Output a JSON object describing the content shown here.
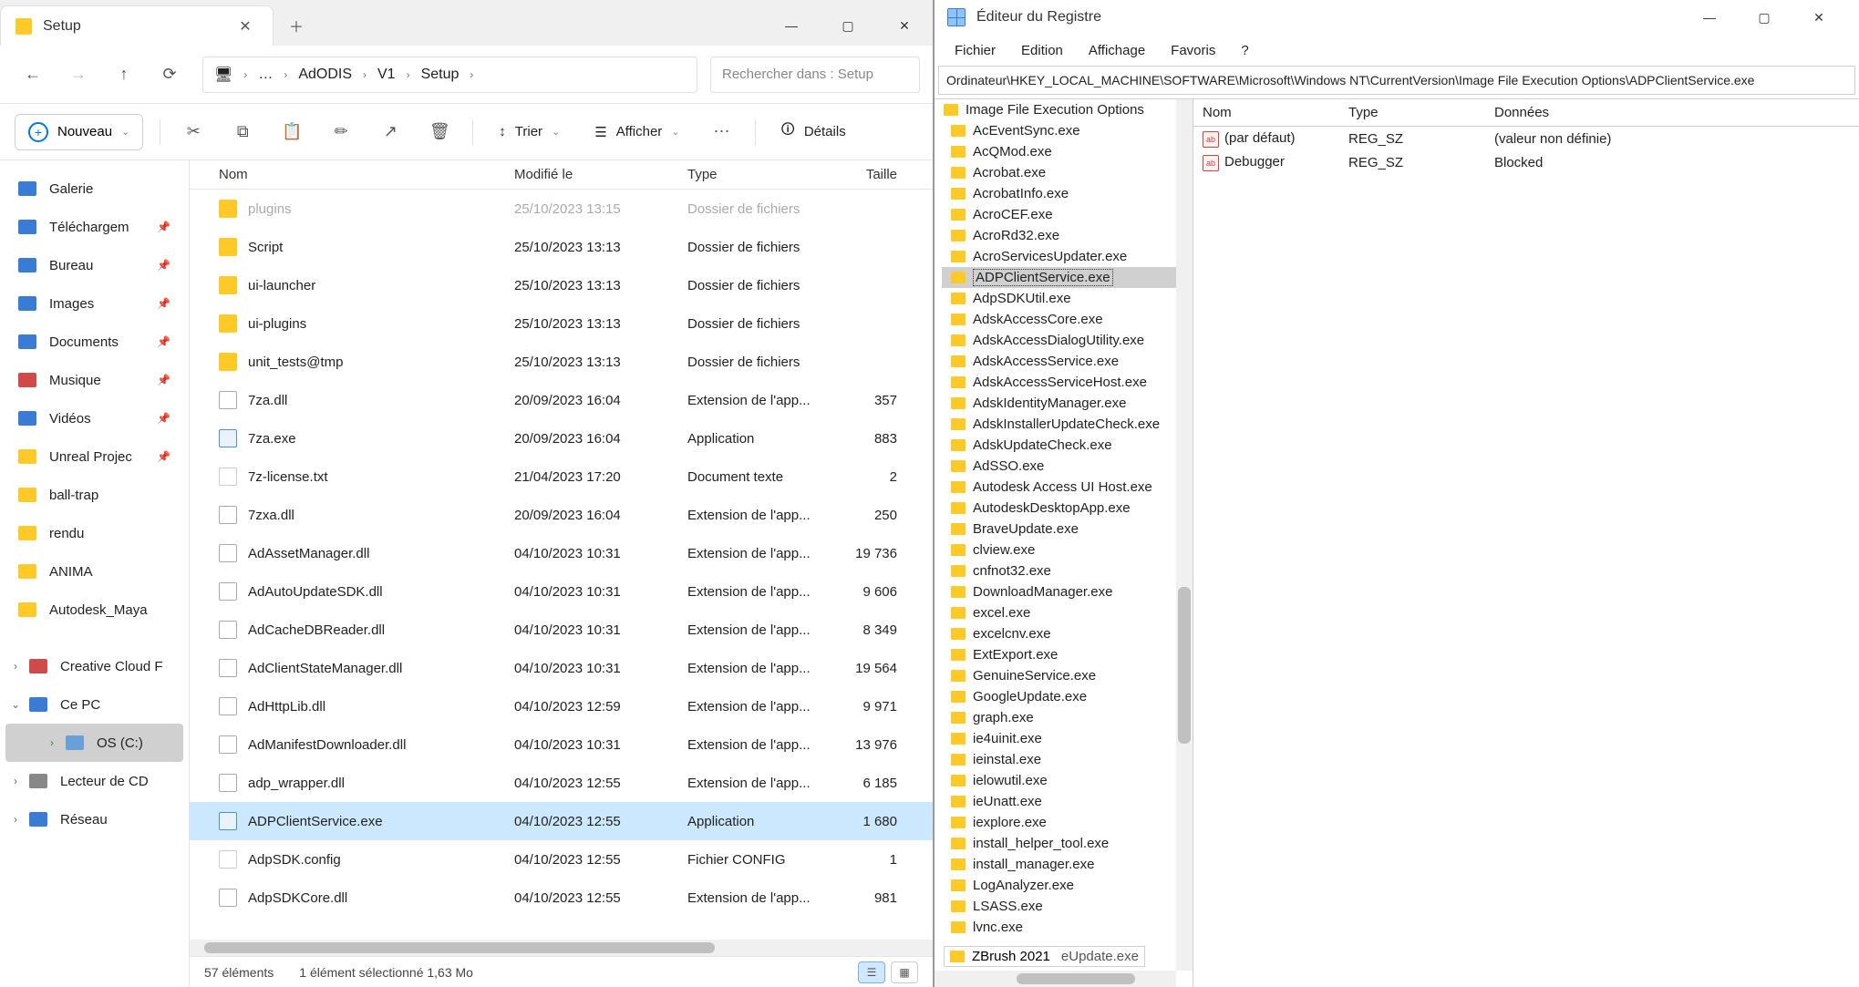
{
  "explorer": {
    "tab_title": "Setup",
    "search_placeholder": "Rechercher dans : Setup",
    "nav": {
      "back": "←",
      "fwd": "→",
      "up": "↑",
      "refresh": "⟳",
      "pc": "🖥"
    },
    "breadcrumbs": [
      "…",
      "AdODIS",
      "V1",
      "Setup"
    ],
    "toolbar": {
      "new": "Nouveau",
      "sort": "Trier",
      "view": "Afficher",
      "details": "Détails"
    },
    "sidebar": [
      {
        "label": "Galerie",
        "color": "#3a7bd5"
      },
      {
        "label": "Téléchargem",
        "color": "#3a7bd5",
        "pin": true
      },
      {
        "label": "Bureau",
        "color": "#3a7bd5",
        "pin": true
      },
      {
        "label": "Images",
        "color": "#3a7bd5",
        "pin": true
      },
      {
        "label": "Documents",
        "color": "#3a7bd5",
        "pin": true
      },
      {
        "label": "Musique",
        "color": "#d04a4a",
        "pin": true
      },
      {
        "label": "Vidéos",
        "color": "#3a7bd5",
        "pin": true
      },
      {
        "label": "Unreal Projec",
        "color": "#ffca28",
        "pin": true
      },
      {
        "label": "ball-trap",
        "color": "#ffca28"
      },
      {
        "label": "rendu",
        "color": "#ffca28"
      },
      {
        "label": "ANIMA",
        "color": "#ffca28"
      },
      {
        "label": "Autodesk_Maya",
        "color": "#ffca28"
      }
    ],
    "sidebar_tree": [
      {
        "label": "Creative Cloud F",
        "color": "#d04a4a",
        "chev": ">"
      },
      {
        "label": "Ce PC",
        "color": "#3a7bd5",
        "chev": "v"
      },
      {
        "label": "OS (C:)",
        "color": "#6aa0d8",
        "chev": ">",
        "sel": true,
        "indent": true
      },
      {
        "label": "Lecteur de CD",
        "color": "#888",
        "chev": ">"
      },
      {
        "label": "Réseau",
        "color": "#3a7bd5",
        "chev": ">"
      }
    ],
    "columns": {
      "name": "Nom",
      "mod": "Modifié le",
      "type": "Type",
      "size": "Taille"
    },
    "files": [
      {
        "icon": "folder",
        "name": "plugins",
        "mod": "25/10/2023 13:15",
        "type": "Dossier de fichiers",
        "size": "",
        "dim": true
      },
      {
        "icon": "folder",
        "name": "Script",
        "mod": "25/10/2023 13:13",
        "type": "Dossier de fichiers",
        "size": ""
      },
      {
        "icon": "folder",
        "name": "ui-launcher",
        "mod": "25/10/2023 13:13",
        "type": "Dossier de fichiers",
        "size": ""
      },
      {
        "icon": "folder",
        "name": "ui-plugins",
        "mod": "25/10/2023 13:13",
        "type": "Dossier de fichiers",
        "size": ""
      },
      {
        "icon": "folder",
        "name": "unit_tests@tmp",
        "mod": "25/10/2023 13:13",
        "type": "Dossier de fichiers",
        "size": ""
      },
      {
        "icon": "dll",
        "name": "7za.dll",
        "mod": "20/09/2023 16:04",
        "type": "Extension de l'app...",
        "size": "357"
      },
      {
        "icon": "exe",
        "name": "7za.exe",
        "mod": "20/09/2023 16:04",
        "type": "Application",
        "size": "883"
      },
      {
        "icon": "file",
        "name": "7z-license.txt",
        "mod": "21/04/2023 17:20",
        "type": "Document texte",
        "size": "2"
      },
      {
        "icon": "dll",
        "name": "7zxa.dll",
        "mod": "20/09/2023 16:04",
        "type": "Extension de l'app...",
        "size": "250"
      },
      {
        "icon": "dll",
        "name": "AdAssetManager.dll",
        "mod": "04/10/2023 10:31",
        "type": "Extension de l'app...",
        "size": "19 736"
      },
      {
        "icon": "dll",
        "name": "AdAutoUpdateSDK.dll",
        "mod": "04/10/2023 10:31",
        "type": "Extension de l'app...",
        "size": "9 606"
      },
      {
        "icon": "dll",
        "name": "AdCacheDBReader.dll",
        "mod": "04/10/2023 10:31",
        "type": "Extension de l'app...",
        "size": "8 349"
      },
      {
        "icon": "dll",
        "name": "AdClientStateManager.dll",
        "mod": "04/10/2023 10:31",
        "type": "Extension de l'app...",
        "size": "19 564"
      },
      {
        "icon": "dll",
        "name": "AdHttpLib.dll",
        "mod": "04/10/2023 12:59",
        "type": "Extension de l'app...",
        "size": "9 971"
      },
      {
        "icon": "dll",
        "name": "AdManifestDownloader.dll",
        "mod": "04/10/2023 10:31",
        "type": "Extension de l'app...",
        "size": "13 976"
      },
      {
        "icon": "dll",
        "name": "adp_wrapper.dll",
        "mod": "04/10/2023 12:55",
        "type": "Extension de l'app...",
        "size": "6 185"
      },
      {
        "icon": "exe",
        "name": "ADPClientService.exe",
        "mod": "04/10/2023 12:55",
        "type": "Application",
        "size": "1 680",
        "selected": true
      },
      {
        "icon": "file",
        "name": "AdpSDK.config",
        "mod": "04/10/2023 12:55",
        "type": "Fichier CONFIG",
        "size": "1"
      },
      {
        "icon": "dll",
        "name": "AdpSDKCore.dll",
        "mod": "04/10/2023 12:55",
        "type": "Extension de l'app...",
        "size": "981"
      }
    ],
    "status": {
      "count": "57 éléments",
      "sel": "1 élément sélectionné  1,63 Mo"
    }
  },
  "regedit": {
    "title": "Éditeur du Registre",
    "menu": [
      "Fichier",
      "Edition",
      "Affichage",
      "Favoris",
      "?"
    ],
    "path": "Ordinateur\\HKEY_LOCAL_MACHINE\\SOFTWARE\\Microsoft\\Windows NT\\CurrentVersion\\Image File Execution Options\\ADPClientService.exe",
    "tree_root": "Image File Execution Options",
    "tree_items": [
      "AcEventSync.exe",
      "AcQMod.exe",
      "Acrobat.exe",
      "AcrobatInfo.exe",
      "AcroCEF.exe",
      "AcroRd32.exe",
      "AcroServicesUpdater.exe",
      "ADPClientService.exe",
      "AdpSDKUtil.exe",
      "AdskAccessCore.exe",
      "AdskAccessDialogUtility.exe",
      "AdskAccessService.exe",
      "AdskAccessServiceHost.exe",
      "AdskIdentityManager.exe",
      "AdskInstallerUpdateCheck.exe",
      "AdskUpdateCheck.exe",
      "AdSSO.exe",
      "Autodesk Access UI Host.exe",
      "AutodeskDesktopApp.exe",
      "BraveUpdate.exe",
      "clview.exe",
      "cnfnot32.exe",
      "DownloadManager.exe",
      "excel.exe",
      "excelcnv.exe",
      "ExtExport.exe",
      "GenuineService.exe",
      "GoogleUpdate.exe",
      "graph.exe",
      "ie4uinit.exe",
      "ieinstal.exe",
      "ielowutil.exe",
      "ieUnatt.exe",
      "iexplore.exe",
      "install_helper_tool.exe",
      "install_manager.exe",
      "LogAnalyzer.exe",
      "LSASS.exe",
      "lvnc.exe"
    ],
    "tree_selected": 7,
    "tree_overlay": "ZBrush 2021",
    "tree_overlay_tail": "eUpdate.exe",
    "columns": {
      "name": "Nom",
      "type": "Type",
      "data": "Données"
    },
    "values": [
      {
        "name": "(par défaut)",
        "type": "REG_SZ",
        "data": "(valeur non définie)"
      },
      {
        "name": "Debugger",
        "type": "REG_SZ",
        "data": "Blocked"
      }
    ]
  }
}
